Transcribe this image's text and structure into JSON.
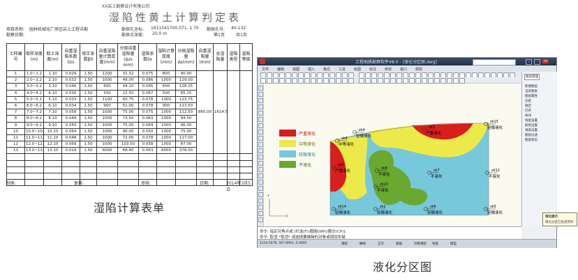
{
  "sheet": {
    "org": "XX岩土勘察设计有限公司",
    "title": "湿陷性黄土计算判定表",
    "project_label": "项目名称:",
    "project_name": "园林机械化厂房区岩土工程详勘",
    "borehole_label": "勘探孔号:",
    "borehole_value": "40-132",
    "coord_label": "勘探孔坐标:",
    "coord_value": "1611541700.071, 1.70",
    "depth_label": "勘探点深度:",
    "depth_value": "20.0 m",
    "date_label": "勘察日期:",
    "sheet_no": "第1页",
    "sheet_total": "共1页",
    "headers": [
      "土样编号",
      "取样深度(m)",
      "取土深度(m)",
      "自重湿陷系数δzs",
      "修正系数β0",
      "自重湿陷量计算厚度(mm)",
      "分级自重湿陷量(Δzs mm)",
      "湿陷系数δs",
      "湿陷计算厚度(mm)",
      "分级湿陷量Δs(mm)",
      "自重湿陷量(mm)",
      "总湿陷量",
      "湿陷类型",
      "湿陷等级"
    ],
    "rows": [
      [
        "1",
        "1.0~1.2",
        "1.10",
        "0.029",
        "1.50",
        "1200",
        "31.32",
        "0.075",
        "800",
        "90.00"
      ],
      [
        "2",
        "2.0~2.2",
        "2.10",
        "0.032",
        "1.50",
        "1000",
        "48.00",
        "0.086",
        "1000",
        "129.00"
      ],
      [
        "3",
        "3.0~3.2",
        "3.10",
        "0.046",
        "1.50",
        "600",
        "44.10",
        "0.095",
        "600",
        "128.25"
      ],
      [
        "4",
        "4.0~4.2",
        "4.10",
        "0.030",
        "1.50",
        "500",
        "22.50",
        "0.067",
        "500",
        "65.25"
      ],
      [
        "5",
        "5.0~5.2",
        "5.10",
        "0.033",
        "1.50",
        "1100",
        "60.75",
        "0.078",
        "1000",
        "123.75"
      ],
      [
        "6",
        "6.0~6.2",
        "6.10",
        "0.034",
        "1.50",
        "900",
        "51.00",
        "0.078",
        "900",
        "113.50"
      ],
      [
        "7",
        "7.0~7.2",
        "7.10",
        "0.058",
        "1.50",
        "1000",
        "75.00",
        "0.075",
        "1000",
        "112.50"
      ],
      [
        "8",
        "8.0~8.2",
        "8.10",
        "0.049",
        "1.50",
        "1000",
        "73.50",
        "0.063",
        "1000",
        "94.50"
      ],
      [
        "9",
        "9.0~9.2",
        "9.10",
        "0.050",
        "1.50",
        "1000",
        "75.00",
        "0.064",
        "1000",
        "96.00"
      ],
      [
        "10",
        "10.0~10.2",
        "10.10",
        "0.064",
        "1.50",
        "1000",
        "90.00",
        "0.050",
        "1000",
        "75.00"
      ],
      [
        "11",
        "11.0~11.2",
        "11.10",
        "0.048",
        "1.50",
        "1000",
        "72.00",
        "0.078",
        "1000",
        "117.00"
      ],
      [
        "12",
        "12.0~12.2",
        "12.10",
        "0.069",
        "1.50",
        "1000",
        "103.50",
        "0.058",
        "1000",
        "87.00"
      ],
      [
        "13",
        "13.0~13.2",
        "13.10",
        "0.019",
        "1.50",
        "6000",
        "68.40",
        "0.063",
        "6000",
        "378.00"
      ]
    ],
    "total_self": "865.00",
    "total_all": "1614.53",
    "footer_preparer": "制表:",
    "footer_checker": "复核:",
    "footer_reviewer": "审核:",
    "footer_date": "日期:",
    "footer_right": "2014年3月5日"
  },
  "caption_left": "湿陷计算表单",
  "caption_right": "液化分区图",
  "cad": {
    "title": "工程地质勘察软件V8.0 - [液化分区图.dwg]",
    "menu": [
      "文件",
      "编辑",
      "视图",
      "插入",
      "格式",
      "工具",
      "绘图",
      "标注",
      "修改",
      "窗口",
      "帮助"
    ],
    "right_header": "图层管理",
    "right_items": [
      "新建图层",
      "当前图层",
      "图层属性",
      "冻结",
      "锁定",
      "打开",
      "关闭",
      "线型设置",
      "颜色设置",
      "线宽设置",
      "图层过滤",
      "图层状态"
    ],
    "legend": [
      "严重液化",
      "中等液化",
      "轻微液化",
      "不液化"
    ],
    "legend_colors": [
      "#d91e1e",
      "#ecea4a",
      "#78c8dc",
      "#6aa830"
    ],
    "points": [
      {
        "id": "zk9",
        "label": "中等液化"
      },
      {
        "id": "zk3",
        "label": "严重液化"
      },
      {
        "id": "zk15",
        "label": "轻微液化"
      },
      {
        "id": "zk1",
        "label": "严重液化"
      },
      {
        "id": "zk8",
        "label": "不液化"
      },
      {
        "id": "zk7",
        "label": "不液化"
      },
      {
        "id": "zk12",
        "label": "不液化"
      },
      {
        "id": "zk14",
        "label": "轻微液化"
      },
      {
        "id": "zk2",
        "label": "轻微液化"
      },
      {
        "id": "zk6",
        "label": "轻微液化"
      },
      {
        "id": "zk5",
        "label": "轻微液化"
      },
      {
        "id": "zk13",
        "label": "不液化"
      },
      {
        "id": "zk4",
        "label": "轻微液化"
      }
    ],
    "cmd_line1": "命令: 指定对角点或 [栏选(F)/圈围(WP)/圈交(CP)]:",
    "cmd_line2": "命令: 取消 *取消*  请选择要编辑的对象或按回车键",
    "popup_title": "液化提示",
    "popup_text": "液化分区已生成完毕",
    "status_coords": "1234.5678, 567.8901, 0.0000",
    "status_items": [
      "捕捉",
      "栅格",
      "正交",
      "极轴",
      "对象捕捉",
      "线宽",
      "模型"
    ]
  }
}
